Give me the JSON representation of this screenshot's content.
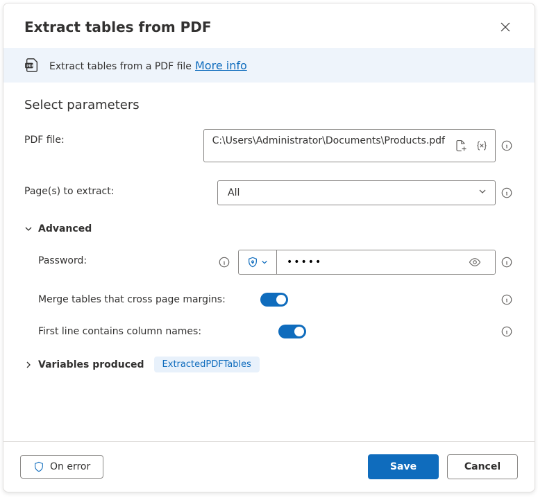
{
  "header": {
    "title": "Extract tables from PDF"
  },
  "banner": {
    "text": "Extract tables from a PDF file",
    "more_info": "More info"
  },
  "section": {
    "title": "Select parameters"
  },
  "fields": {
    "pdf_file_label": "PDF file:",
    "pdf_file_value": "C:\\Users\\Administrator\\Documents\\Products.pdf",
    "pages_label": "Page(s) to extract:",
    "pages_value": "All",
    "advanced_label": "Advanced",
    "password_label": "Password:",
    "password_value": "•••••",
    "merge_label": "Merge tables that cross page margins:",
    "firstline_label": "First line contains column names:",
    "vars_label": "Variables produced",
    "vars_badge": "ExtractedPDFTables"
  },
  "footer": {
    "on_error": "On error",
    "save": "Save",
    "cancel": "Cancel"
  }
}
